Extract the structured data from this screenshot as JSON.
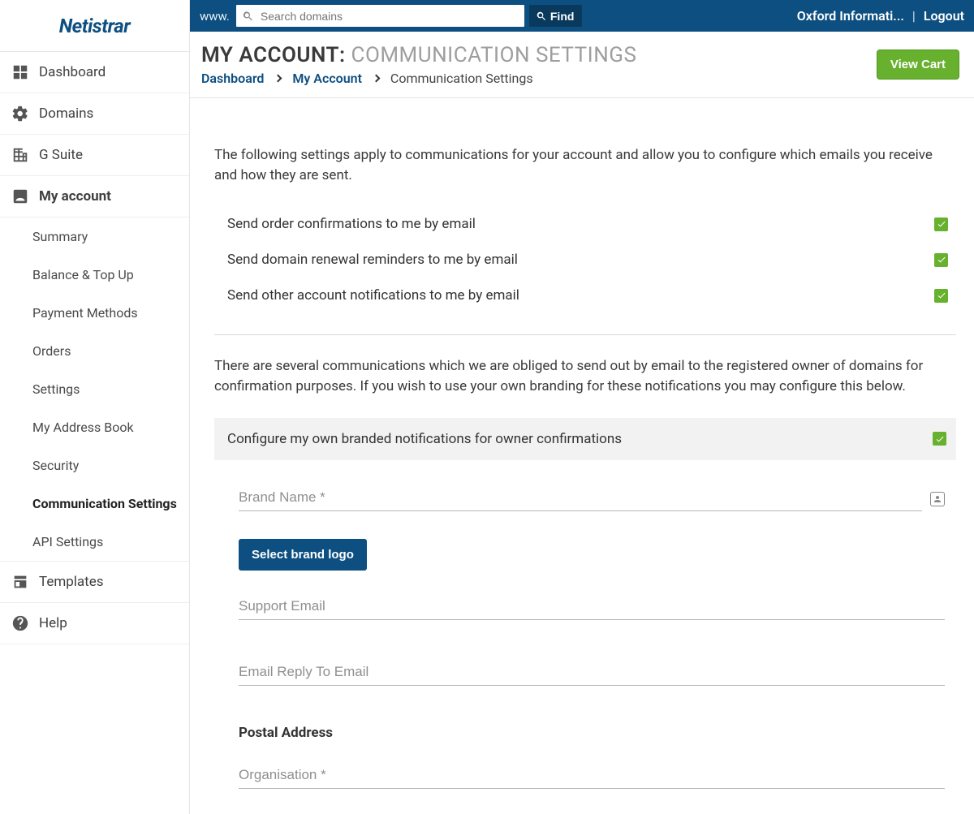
{
  "brand": {
    "name": "Netistrar"
  },
  "topbar": {
    "prefix": "www.",
    "search_placeholder": "Search domains",
    "find_label": "Find",
    "account_name": "Oxford Informati...",
    "logout_label": "Logout"
  },
  "header": {
    "title_prefix": "MY ACCOUNT:",
    "title_suffix": "COMMUNICATION SETTINGS",
    "crumbs": {
      "dashboard": "Dashboard",
      "my_account": "My Account",
      "current": "Communication Settings"
    },
    "view_cart_label": "View Cart"
  },
  "sidebar": {
    "items": [
      {
        "label": "Dashboard"
      },
      {
        "label": "Domains"
      },
      {
        "label": "G Suite"
      },
      {
        "label": "My account"
      },
      {
        "label": "Templates"
      },
      {
        "label": "Help"
      }
    ],
    "account_sub": [
      {
        "label": "Summary"
      },
      {
        "label": "Balance & Top Up"
      },
      {
        "label": "Payment Methods"
      },
      {
        "label": "Orders"
      },
      {
        "label": "Settings"
      },
      {
        "label": "My Address Book"
      },
      {
        "label": "Security"
      },
      {
        "label": "Communication Settings"
      },
      {
        "label": "API Settings"
      }
    ]
  },
  "content": {
    "intro": "The following settings apply to communications for your account and allow you to configure which emails you receive and how they are sent.",
    "options": {
      "order_conf": "Send order confirmations to me by email",
      "renewal": "Send domain renewal reminders to me by email",
      "other": "Send other account notifications to me by email"
    },
    "branding_intro": "There are several communications which we are obliged to send out by email to the registered owner of domains for confirmation purposes. If you wish to use your own branding for these notifications you may configure this below.",
    "branding_toggle": "Configure my own branded notifications for owner confirmations",
    "form": {
      "brand_name": "Brand Name *",
      "select_logo": "Select brand logo",
      "support_email": "Support Email",
      "reply_to_email": "Email Reply To Email",
      "postal_heading": "Postal Address",
      "organisation": "Organisation *"
    }
  },
  "colors": {
    "primary": "#0d4f81",
    "accent_green": "#68b12f"
  }
}
